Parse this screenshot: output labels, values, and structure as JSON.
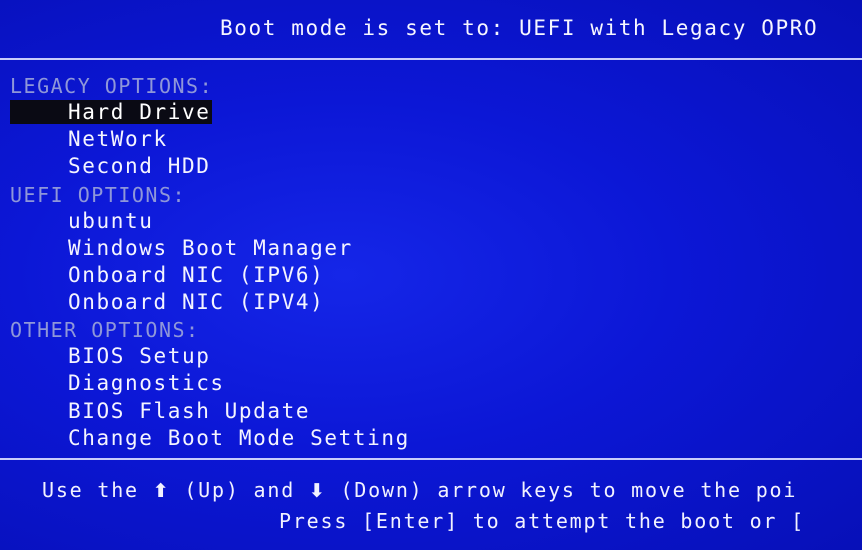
{
  "header": {
    "title": "Boot mode is set to: UEFI with Legacy OPRO"
  },
  "menu": {
    "legacy": {
      "title": "LEGACY OPTIONS:",
      "items": [
        "Hard Drive",
        "NetWork",
        "Second HDD"
      ]
    },
    "uefi": {
      "title": "UEFI OPTIONS:",
      "items": [
        "ubuntu",
        "Windows Boot Manager",
        "Onboard NIC (IPV6)",
        "Onboard NIC (IPV4)"
      ]
    },
    "other": {
      "title": "OTHER OPTIONS:",
      "items": [
        "BIOS Setup",
        "Diagnostics",
        "BIOS Flash Update",
        "Change Boot Mode Setting"
      ]
    },
    "selected_item": "Hard Drive"
  },
  "footer": {
    "line1_use": "Use the",
    "up_arrow": "⬆",
    "up_label": "(Up) and",
    "down_arrow": "⬇",
    "down_label": "(Down) arrow keys to move the poi",
    "line2": "Press [Enter] to attempt the boot or ["
  },
  "colors": {
    "background": "#0c17d6",
    "selection_bar": "#0a0a14",
    "section_title": "#8f97d9",
    "text": "#f4f4ff"
  }
}
